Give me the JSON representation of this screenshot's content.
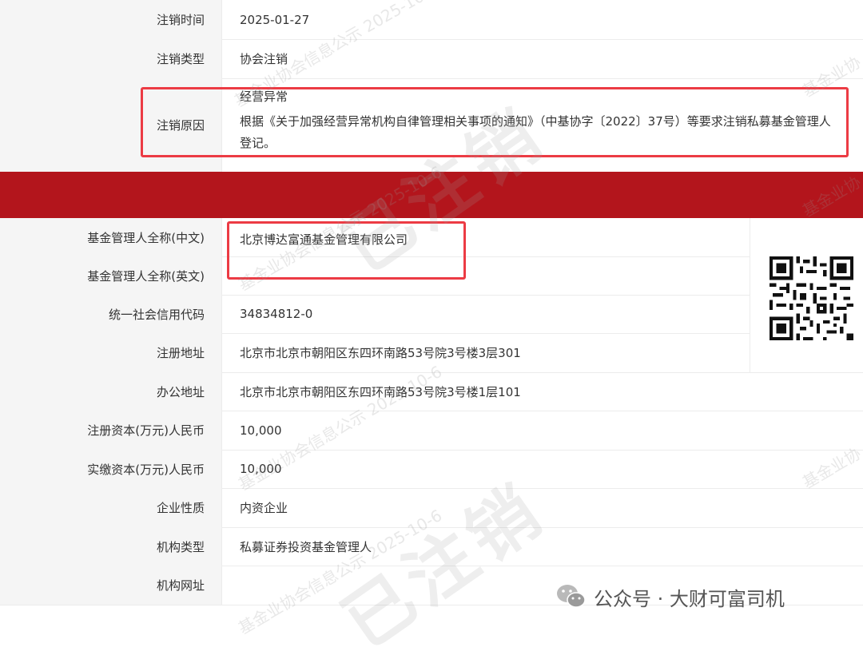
{
  "rows_top": [
    {
      "label": "注销时间",
      "value": "2025-01-27"
    },
    {
      "label": "注销类型",
      "value": "协会注销"
    }
  ],
  "reason": {
    "label": "注销原因",
    "line1": "经营异常",
    "line2": "根据《关于加强经营异常机构自律管理相关事项的通知》（中基协字〔2022〕37号）等要求注销私募基金管理人登记。"
  },
  "rows_main": [
    {
      "label": "基金管理人全称(中文)",
      "value": "北京博达富通基金管理有限公司"
    },
    {
      "label": "基金管理人全称(英文)",
      "value": ""
    },
    {
      "label": "统一社会信用代码",
      "value": "34834812-0"
    },
    {
      "label": "注册地址",
      "value": "北京市北京市朝阳区东四环南路53号院3号楼3层301"
    },
    {
      "label": "办公地址",
      "value": "北京市北京市朝阳区东四环南路53号院3号楼1层101"
    },
    {
      "label": "注册资本(万元)人民币",
      "value": "10,000"
    },
    {
      "label": "实缴资本(万元)人民币",
      "value": "10,000"
    },
    {
      "label": "企业性质",
      "value": "内资企业"
    },
    {
      "label": "机构类型",
      "value": "私募证券投资基金管理人"
    },
    {
      "label": "机构网址",
      "value": ""
    }
  ],
  "watermarks": {
    "small": "基金业协会信息公示 2025-10-6",
    "edge": "基金业协",
    "big": "已注销"
  },
  "footer": {
    "text": "公众号 · 大财可富司机",
    "icon": "wechat-icon"
  },
  "colors": {
    "band": "#b3151c",
    "highlight": "#ec3b44"
  }
}
